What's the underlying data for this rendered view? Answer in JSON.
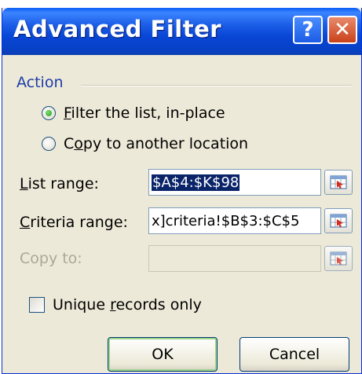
{
  "window": {
    "title": "Advanced Filter",
    "help_label": "?",
    "close_label": "✕"
  },
  "action_group": {
    "label": "Action",
    "options": [
      {
        "text": "Filter the list, in-place",
        "mnemonic": "F",
        "selected": true
      },
      {
        "text": "Copy to another location",
        "mnemonic": "o",
        "selected": false
      }
    ]
  },
  "fields": {
    "list_range": {
      "label": "List range:",
      "value": "$A$4:$K$98",
      "selected": true,
      "enabled": true
    },
    "criteria_range": {
      "label": "Criteria range:",
      "value": "x]criteria!$B$3:$C$5",
      "selected": false,
      "enabled": true
    },
    "copy_to": {
      "label": "Copy to:",
      "value": "",
      "selected": false,
      "enabled": false
    }
  },
  "unique_records": {
    "label": "Unique records only",
    "checked": false
  },
  "buttons": {
    "ok": "OK",
    "cancel": "Cancel"
  },
  "icons": {
    "range_collapse": "range-select-icon",
    "help": "question-icon",
    "close": "close-icon"
  },
  "colors": {
    "title_bar": "#0846d6",
    "dialog_bg": "#ece9d8",
    "group_label": "#1e3ca8",
    "selection": "#0a246a",
    "close_button": "#c8411a"
  }
}
